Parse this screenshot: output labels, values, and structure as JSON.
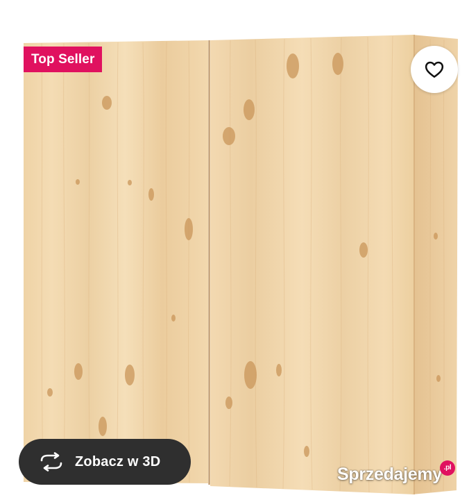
{
  "badge": {
    "label": "Top Seller",
    "color": "#e0115f"
  },
  "favorite": {
    "icon": "heart-outline-icon"
  },
  "view_3d": {
    "label": "Zobacz w 3D",
    "icon": "rotate-arrows-icon"
  },
  "watermark": {
    "text": "Sprzedajemy",
    "suffix": ".pl"
  },
  "product_image": {
    "subject": "pine-wood-two-door-cabinet"
  },
  "colors": {
    "wood_light": "#f2d7ad",
    "wood_mid": "#e9c99a",
    "pill_bg": "#2f2f2f",
    "accent": "#e0115f"
  }
}
